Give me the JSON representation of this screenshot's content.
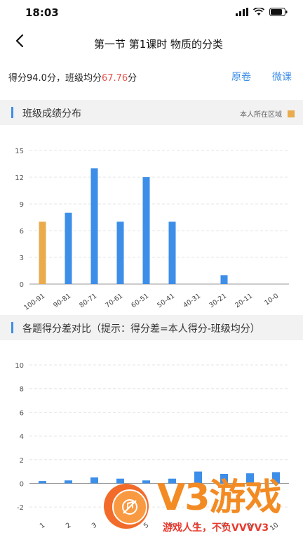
{
  "status_bar": {
    "time": "18:03"
  },
  "header": {
    "title": "第一节 第1课时 物质的分类"
  },
  "score": {
    "prefix": "得分94.0分，班级均分",
    "average": "67.76",
    "suffix": "分",
    "average_color": "#e5534b"
  },
  "links": {
    "original": "原卷",
    "micro_lesson": "微课"
  },
  "section1": {
    "title": "班级成绩分布",
    "legend": "本人所在区域"
  },
  "section2": {
    "title": "各题得分差对比（提示：得分差=本人得分-班级均分）"
  },
  "colors": {
    "accent": "#3d8ee8",
    "highlight": "#e9ab4c",
    "bar": "#3d8ee8"
  },
  "chart_data": [
    {
      "type": "bar",
      "title": "班级成绩分布",
      "categories": [
        "100-91",
        "90-81",
        "80-71",
        "70-61",
        "60-51",
        "50-41",
        "40-31",
        "30-21",
        "20-11",
        "10-0"
      ],
      "values": [
        7,
        8,
        13,
        7,
        12,
        7,
        0,
        1,
        0,
        0
      ],
      "highlight_index": 0,
      "ylim": [
        0,
        15
      ],
      "yticks": [
        0,
        3,
        6,
        9,
        12,
        15
      ],
      "grid": true
    },
    {
      "type": "bar",
      "title": "各题得分差对比",
      "categories": [
        "1",
        "2",
        "3",
        "4",
        "5",
        "6",
        "7",
        "8",
        "9",
        "10"
      ],
      "values": [
        0.2,
        0.25,
        0.5,
        0.4,
        0.25,
        0.4,
        1.0,
        0.8,
        0.85,
        0.95
      ],
      "ylim": [
        -3,
        10
      ],
      "yticks": [
        -2,
        0,
        2,
        4,
        6,
        8,
        10
      ],
      "grid": true
    }
  ],
  "watermark": {
    "logo": "V3游戏",
    "slogan": "游戏人生，不负VVVV3"
  }
}
